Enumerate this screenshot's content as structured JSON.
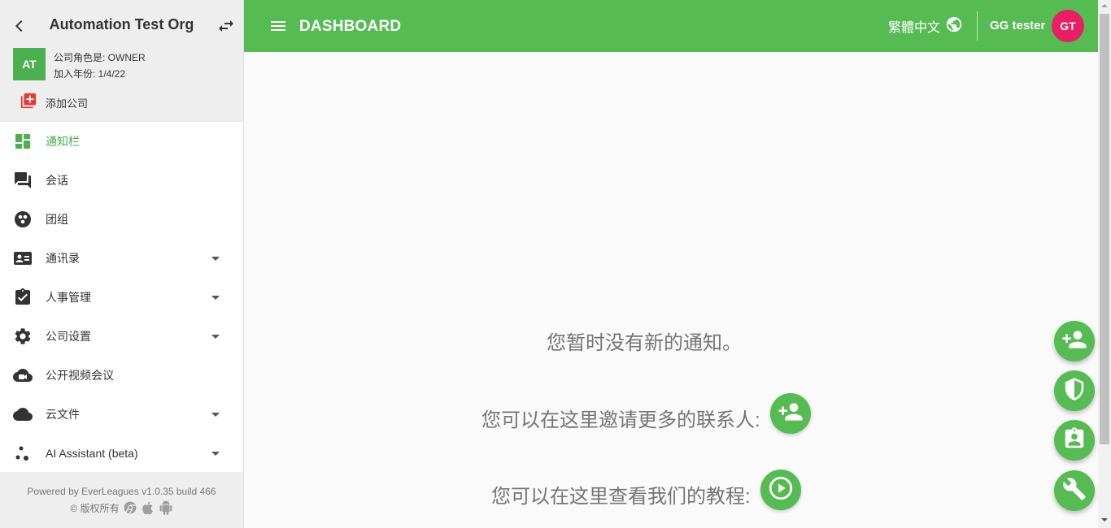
{
  "sidebar": {
    "org_name": "Automation Test Org",
    "org_avatar": "AT",
    "role_text": "公司角色是: OWNER",
    "joined_text": "加入年份: 1/4/22",
    "add_company_label": "添加公司",
    "items": [
      {
        "label": "通知栏",
        "icon": "dashboard-icon",
        "active": true,
        "expandable": false
      },
      {
        "label": "会话",
        "icon": "forum-icon",
        "active": false,
        "expandable": false
      },
      {
        "label": "团组",
        "icon": "group-icon",
        "active": false,
        "expandable": false
      },
      {
        "label": "通讯录",
        "icon": "contacts-icon",
        "active": false,
        "expandable": true
      },
      {
        "label": "人事管理",
        "icon": "assignment-check-icon",
        "active": false,
        "expandable": true
      },
      {
        "label": "公司设置",
        "icon": "gear-icon",
        "active": false,
        "expandable": true
      },
      {
        "label": "公开视频会议",
        "icon": "video-cloud-icon",
        "active": false,
        "expandable": false
      },
      {
        "label": "云文件",
        "icon": "cloud-icon",
        "active": false,
        "expandable": true
      },
      {
        "label": "AI Assistant (beta)",
        "icon": "ai-dots-icon",
        "active": false,
        "expandable": true
      }
    ],
    "footer": {
      "powered_by": "Powered by EverLeagues v1.0.35 build 466",
      "copyright": "© 版权所有"
    }
  },
  "header": {
    "title": "DASHBOARD",
    "language": "繁體中文",
    "user_name": "GG tester",
    "user_initials": "GT"
  },
  "main": {
    "no_notifications": "您暂时没有新的通知。",
    "invite_text": "您可以在这里邀请更多的联系人:",
    "tutorial_text": "您可以在这里查看我们的教程:"
  },
  "colors": {
    "primary_green": "#55bb52",
    "avatar_pink": "#e91e63",
    "active_green": "#4caf50",
    "add_company_red": "#e53935"
  }
}
